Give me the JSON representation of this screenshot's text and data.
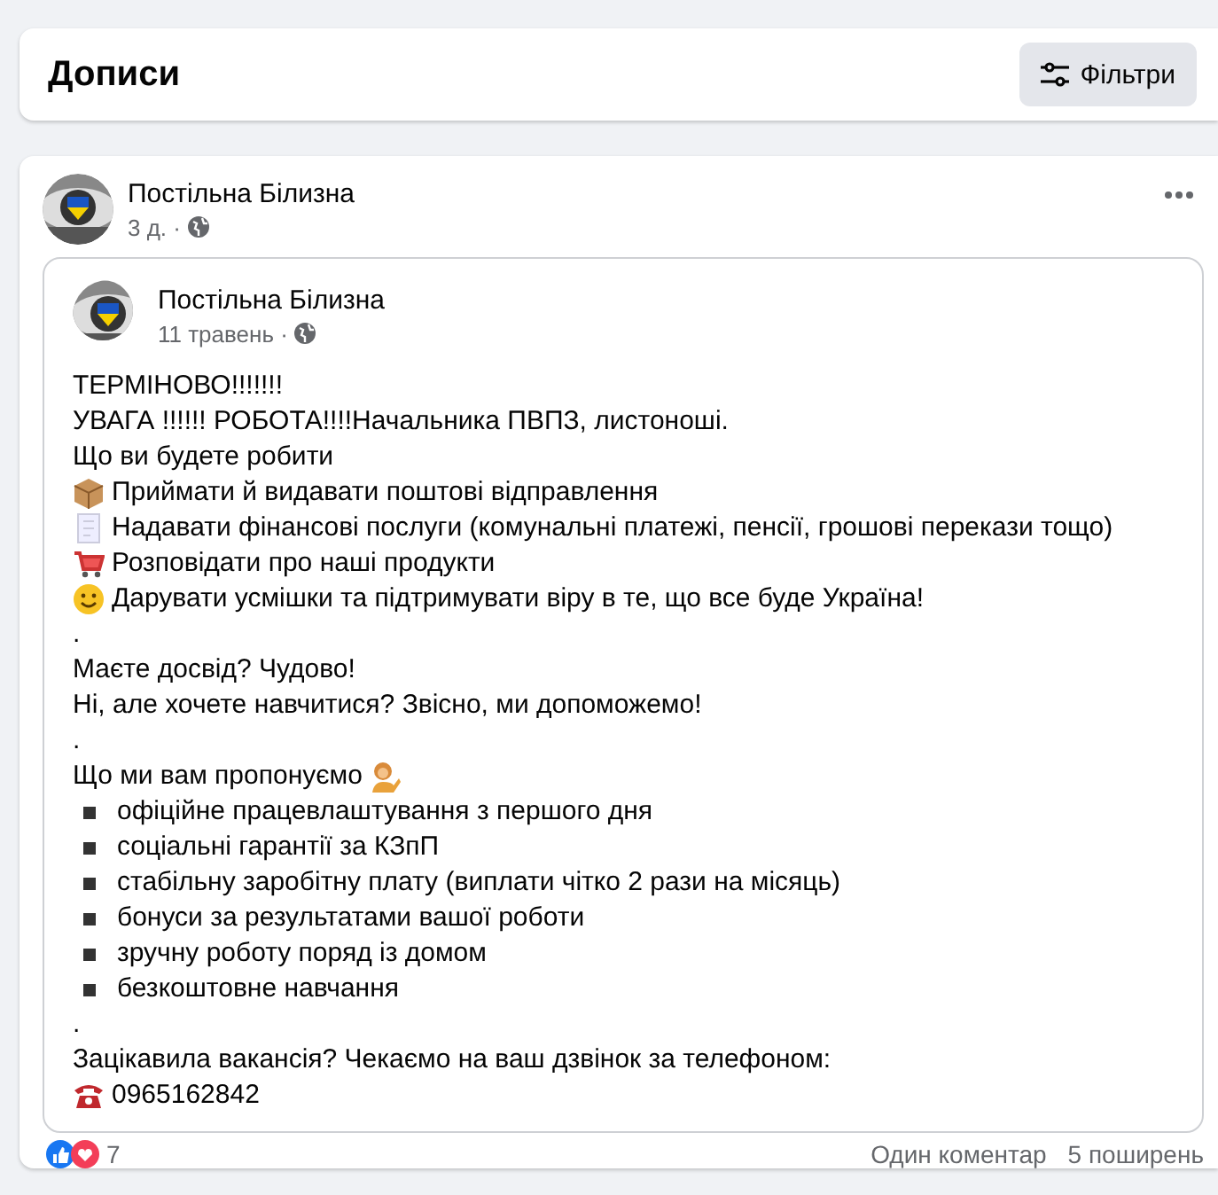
{
  "header": {
    "title": "Дописи",
    "filter_button": "Фільтри"
  },
  "post": {
    "author": "Постільна Білизна",
    "time": "3 д. ·",
    "shared": {
      "author": "Постільна Білизна",
      "time": "11 травень ·",
      "lines": [
        {
          "kind": "text",
          "text": "ТЕРМІНОВО!!!!!!!"
        },
        {
          "kind": "text",
          "text": "УВАГА !!!!!! РОБОТА!!!!Начальника ПВПЗ, листоноші."
        },
        {
          "kind": "text",
          "text": "Що ви будете робити"
        },
        {
          "kind": "box",
          "text": "Приймати й видавати поштові відправлення"
        },
        {
          "kind": "receipt",
          "text": "Надавати фінансові послуги (комунальні платежі, пенсії, грошові перекази тощо)"
        },
        {
          "kind": "cart",
          "text": "Розповідати про наші продукти"
        },
        {
          "kind": "smile",
          "text": "Дарувати усмішки та підтримувати віру в те, що все буде Україна!"
        },
        {
          "kind": "text",
          "text": "."
        },
        {
          "kind": "text",
          "text": "Маєте досвід? Чудово!"
        },
        {
          "kind": "text",
          "text": "Ні, але хочете навчитися? Звісно, ми допоможемо!"
        },
        {
          "kind": "text",
          "text": "."
        },
        {
          "kind": "person",
          "text": "Що ми вам пропонуємо"
        },
        {
          "kind": "bullet",
          "text": "офіційне працевлаштування з першого дня"
        },
        {
          "kind": "bullet",
          "text": "соціальні гарантії за КЗпП"
        },
        {
          "kind": "bullet",
          "text": "стабільну заробітну плату (виплати чітко 2 рази на місяць)"
        },
        {
          "kind": "bullet",
          "text": "бонуси за результатами вашої роботи"
        },
        {
          "kind": "bullet",
          "text": "зручну роботу поряд із домом"
        },
        {
          "kind": "bullet",
          "text": "безкоштовне навчання"
        },
        {
          "kind": "text",
          "text": "."
        },
        {
          "kind": "text",
          "text": "Зацікавила вакансія? Чекаємо на ваш дзвінок за телефоном:"
        },
        {
          "kind": "phone",
          "text": "0965162842"
        }
      ]
    },
    "reactions": "7",
    "comments": "Один коментар",
    "shares": "5 поширень"
  }
}
